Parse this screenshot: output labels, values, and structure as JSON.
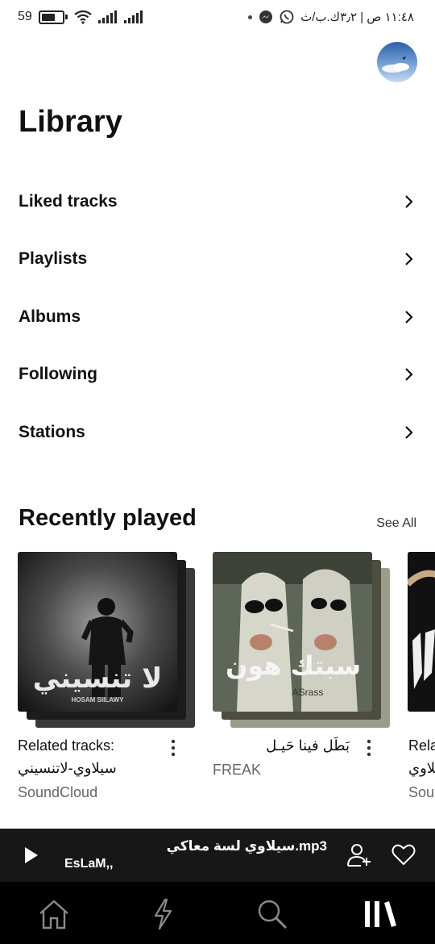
{
  "status_bar": {
    "battery": "59",
    "time_text": "١١:٤٨ ص | ٣٫٢ك.ب/ث"
  },
  "page": {
    "title": "Library"
  },
  "menu": [
    {
      "label": "Liked tracks"
    },
    {
      "label": "Playlists"
    },
    {
      "label": "Albums"
    },
    {
      "label": "Following"
    },
    {
      "label": "Stations"
    }
  ],
  "recently_played": {
    "title": "Recently played",
    "see_all": "See All",
    "items": [
      {
        "line1": "Related tracks:",
        "line2": "سيلاوي-لاتنسيني",
        "subtitle": "SoundCloud",
        "art_text": "لا تنسيني",
        "art_caption": "HOSAM SIILAWY"
      },
      {
        "line1": "بَطَل فينا حَيـل",
        "subtitle": "FREAK",
        "art_text": "سبتك هون",
        "art_caption": "ASrass"
      },
      {
        "line1": "Rela",
        "line2": "سيلاوي",
        "subtitle": "Sou"
      }
    ]
  },
  "player": {
    "song": "سيلاوي لسة معاكي.mp3",
    "artist": "EsLaM,,"
  },
  "icons": {
    "battery": "battery-icon",
    "wifi": "wifi-icon",
    "signal": "signal-icon",
    "whatsapp": "whatsapp-icon",
    "messenger": "messenger-icon",
    "chevron": "chevron-right-icon",
    "more": "more-vert-icon",
    "play": "play-icon",
    "add_user": "add-user-icon",
    "heart": "heart-icon",
    "home": "home-icon",
    "feed": "lightning-icon",
    "search": "search-icon",
    "library": "library-icon"
  },
  "colors": {
    "player_bg": "#171717",
    "nav_bg": "#000000",
    "text": "#111111",
    "muted": "#666666"
  }
}
